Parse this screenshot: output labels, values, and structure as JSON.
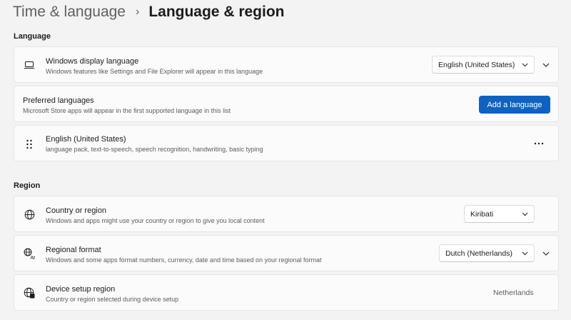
{
  "breadcrumb": {
    "parent": "Time & language",
    "separator": "›",
    "current": "Language & region"
  },
  "sections": {
    "language": "Language",
    "region": "Region"
  },
  "display_language": {
    "title": "Windows display language",
    "subtitle": "Windows features like Settings and File Explorer will appear in this language",
    "value": "English (United States)",
    "icon": "laptop-icon"
  },
  "preferred_languages": {
    "title": "Preferred languages",
    "subtitle": "Microsoft Store apps will appear in the first supported language in this list",
    "button_label": "Add a language"
  },
  "language_item": {
    "title": "English (United States)",
    "subtitle": "language pack, text-to-speech, speech recognition, handwriting, basic typing",
    "icon": "drag-handle-icon"
  },
  "country": {
    "title": "Country or region",
    "subtitle": "Windows and apps might use your country or region to give you local content",
    "value": "Kiribati",
    "icon": "globe-icon"
  },
  "regional_format": {
    "title": "Regional format",
    "subtitle": "Windows and some apps format numbers, currency, date and time based on your regional format",
    "value": "Dutch (Netherlands)",
    "icon": "regional-format-icon"
  },
  "device_setup_region": {
    "title": "Device setup region",
    "subtitle": "Country or region selected during device setup",
    "value": "Netherlands",
    "icon": "globe-device-icon"
  },
  "colors": {
    "accent": "#0f62bf",
    "background": "#f3f3f3",
    "card": "#fbfbfb"
  }
}
